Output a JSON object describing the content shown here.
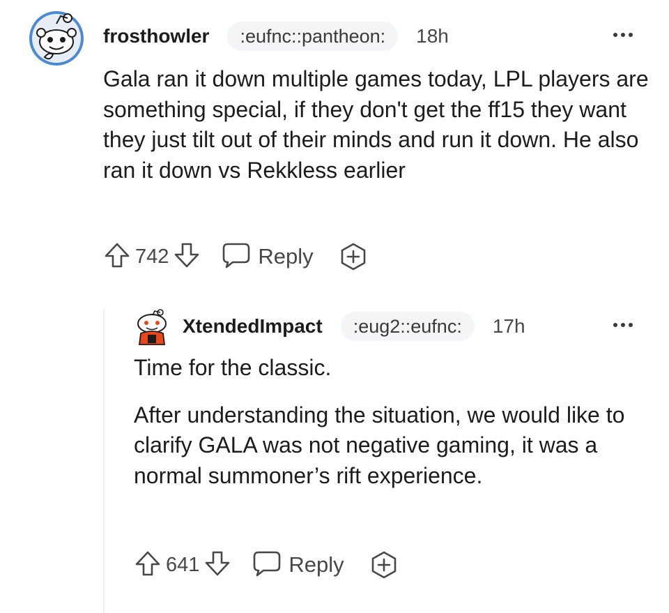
{
  "comments": [
    {
      "username": "frosthowler",
      "flair": ":eufnc::pantheon:",
      "time": "18h",
      "paragraphs": [
        "Gala ran it down multiple games today, LPL players are something special, if they don't get the ff15 they want they just tilt out of their minds and run it down. He also ran it down vs Rekkless earlier"
      ],
      "votes": "742",
      "reply_label": "Reply",
      "avatar_icon": "snoo-avatar-default",
      "colors": {
        "avatar_bg": "#3d7fc9"
      }
    },
    {
      "username": "XtendedImpact",
      "flair": ":eug2::eufnc:",
      "time": "17h",
      "paragraphs": [
        "Time for the classic.",
        "After understanding the situation, we would like to clarify GALA was not negative gaming, it was a normal summoner’s rift experience."
      ],
      "votes": "641",
      "reply_label": "Reply",
      "avatar_icon": "snoo-avatar-custom",
      "colors": {
        "avatar_accent": "#e8471c"
      }
    }
  ]
}
